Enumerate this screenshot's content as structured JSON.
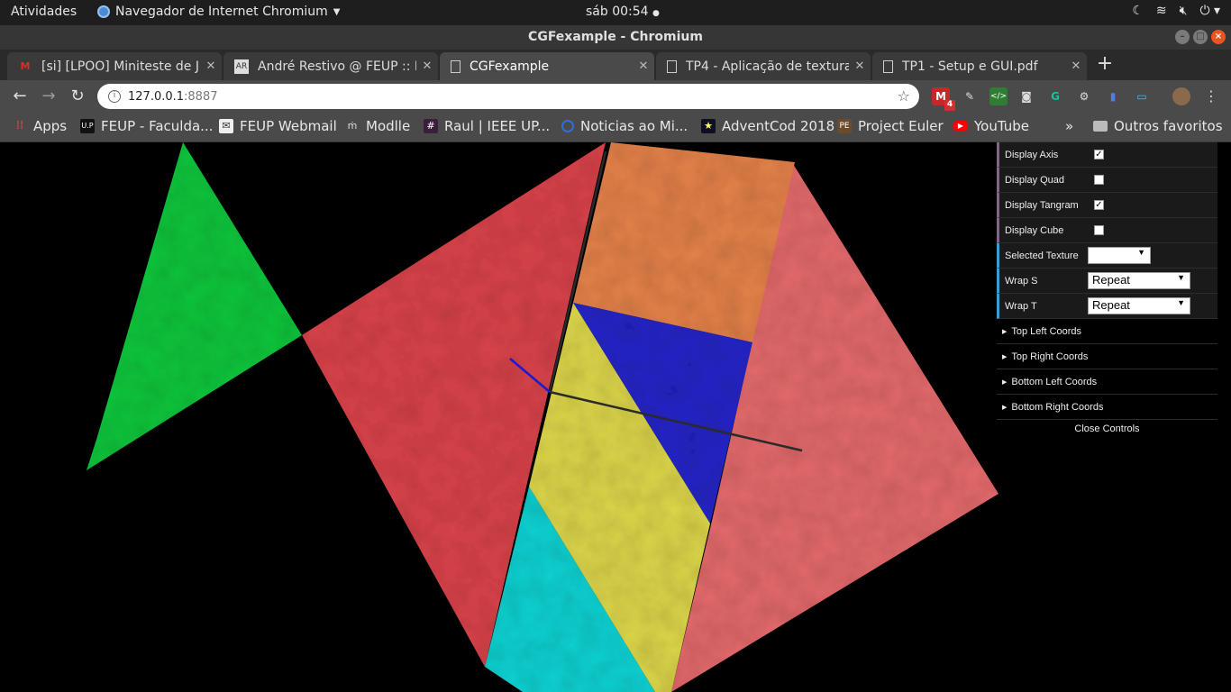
{
  "ubuntu_bar": {
    "activities": "Atividades",
    "app_name": "Navegador de Internet Chromium",
    "clock": "sáb 00:54"
  },
  "window": {
    "title": "CGFexample - Chromium"
  },
  "tabs": [
    {
      "title": "[si] [LPOO] Miniteste de J",
      "favicon": "gmail-icon"
    },
    {
      "title": "André Restivo @ FEUP :: L",
      "favicon": "ar-icon"
    },
    {
      "title": "CGFexample",
      "favicon": "page-icon",
      "active": true
    },
    {
      "title": "TP4 - Aplicação de textura",
      "favicon": "page-icon"
    },
    {
      "title": "TP1 - Setup e GUI.pdf",
      "favicon": "page-icon"
    }
  ],
  "toolbar": {
    "url_host": "127.0.0.1",
    "url_port": ":8887",
    "gmail_badge": "4"
  },
  "bookmarks": [
    {
      "label": "Apps",
      "icon": "apps-grid-icon"
    },
    {
      "label": "FEUP - Faculda...",
      "icon": "feup-icon"
    },
    {
      "label": "FEUP Webmail",
      "icon": "mail-icon"
    },
    {
      "label": "Modlle",
      "icon": "moodle-icon"
    },
    {
      "label": "Raul | IEEE UP...",
      "icon": "slack-icon"
    },
    {
      "label": "Noticias ao Mi...",
      "icon": "news-icon"
    },
    {
      "label": "AdventCod 2018",
      "icon": "star-icon"
    },
    {
      "label": "Project Euler",
      "icon": "euler-icon"
    },
    {
      "label": "YouTube",
      "icon": "youtube-icon"
    }
  ],
  "bookmarks_more": "»",
  "other_bookmarks": "Outros favoritos",
  "gui": {
    "display_axis": {
      "label": "Display Axis",
      "checked": true
    },
    "display_quad": {
      "label": "Display Quad",
      "checked": false
    },
    "display_tangram": {
      "label": "Display Tangram",
      "checked": true
    },
    "display_cube": {
      "label": "Display Cube",
      "checked": false
    },
    "selected_texture": {
      "label": "Selected Texture",
      "value": ""
    },
    "wrap_s": {
      "label": "Wrap S",
      "value": "Repeat"
    },
    "wrap_t": {
      "label": "Wrap T",
      "value": "Repeat"
    },
    "folders": [
      "Top Left Coords",
      "Top Right Coords",
      "Bottom Left Coords",
      "Bottom Right Coords"
    ],
    "close_controls": "Close Controls"
  },
  "scene_colors": {
    "green": "#10c63c",
    "red": "#d9434a",
    "orange": "#e4824a",
    "pink": "#e46a6c",
    "blue": "#2424c8",
    "yellow": "#dcd64a",
    "cyan": "#12d2d2"
  }
}
